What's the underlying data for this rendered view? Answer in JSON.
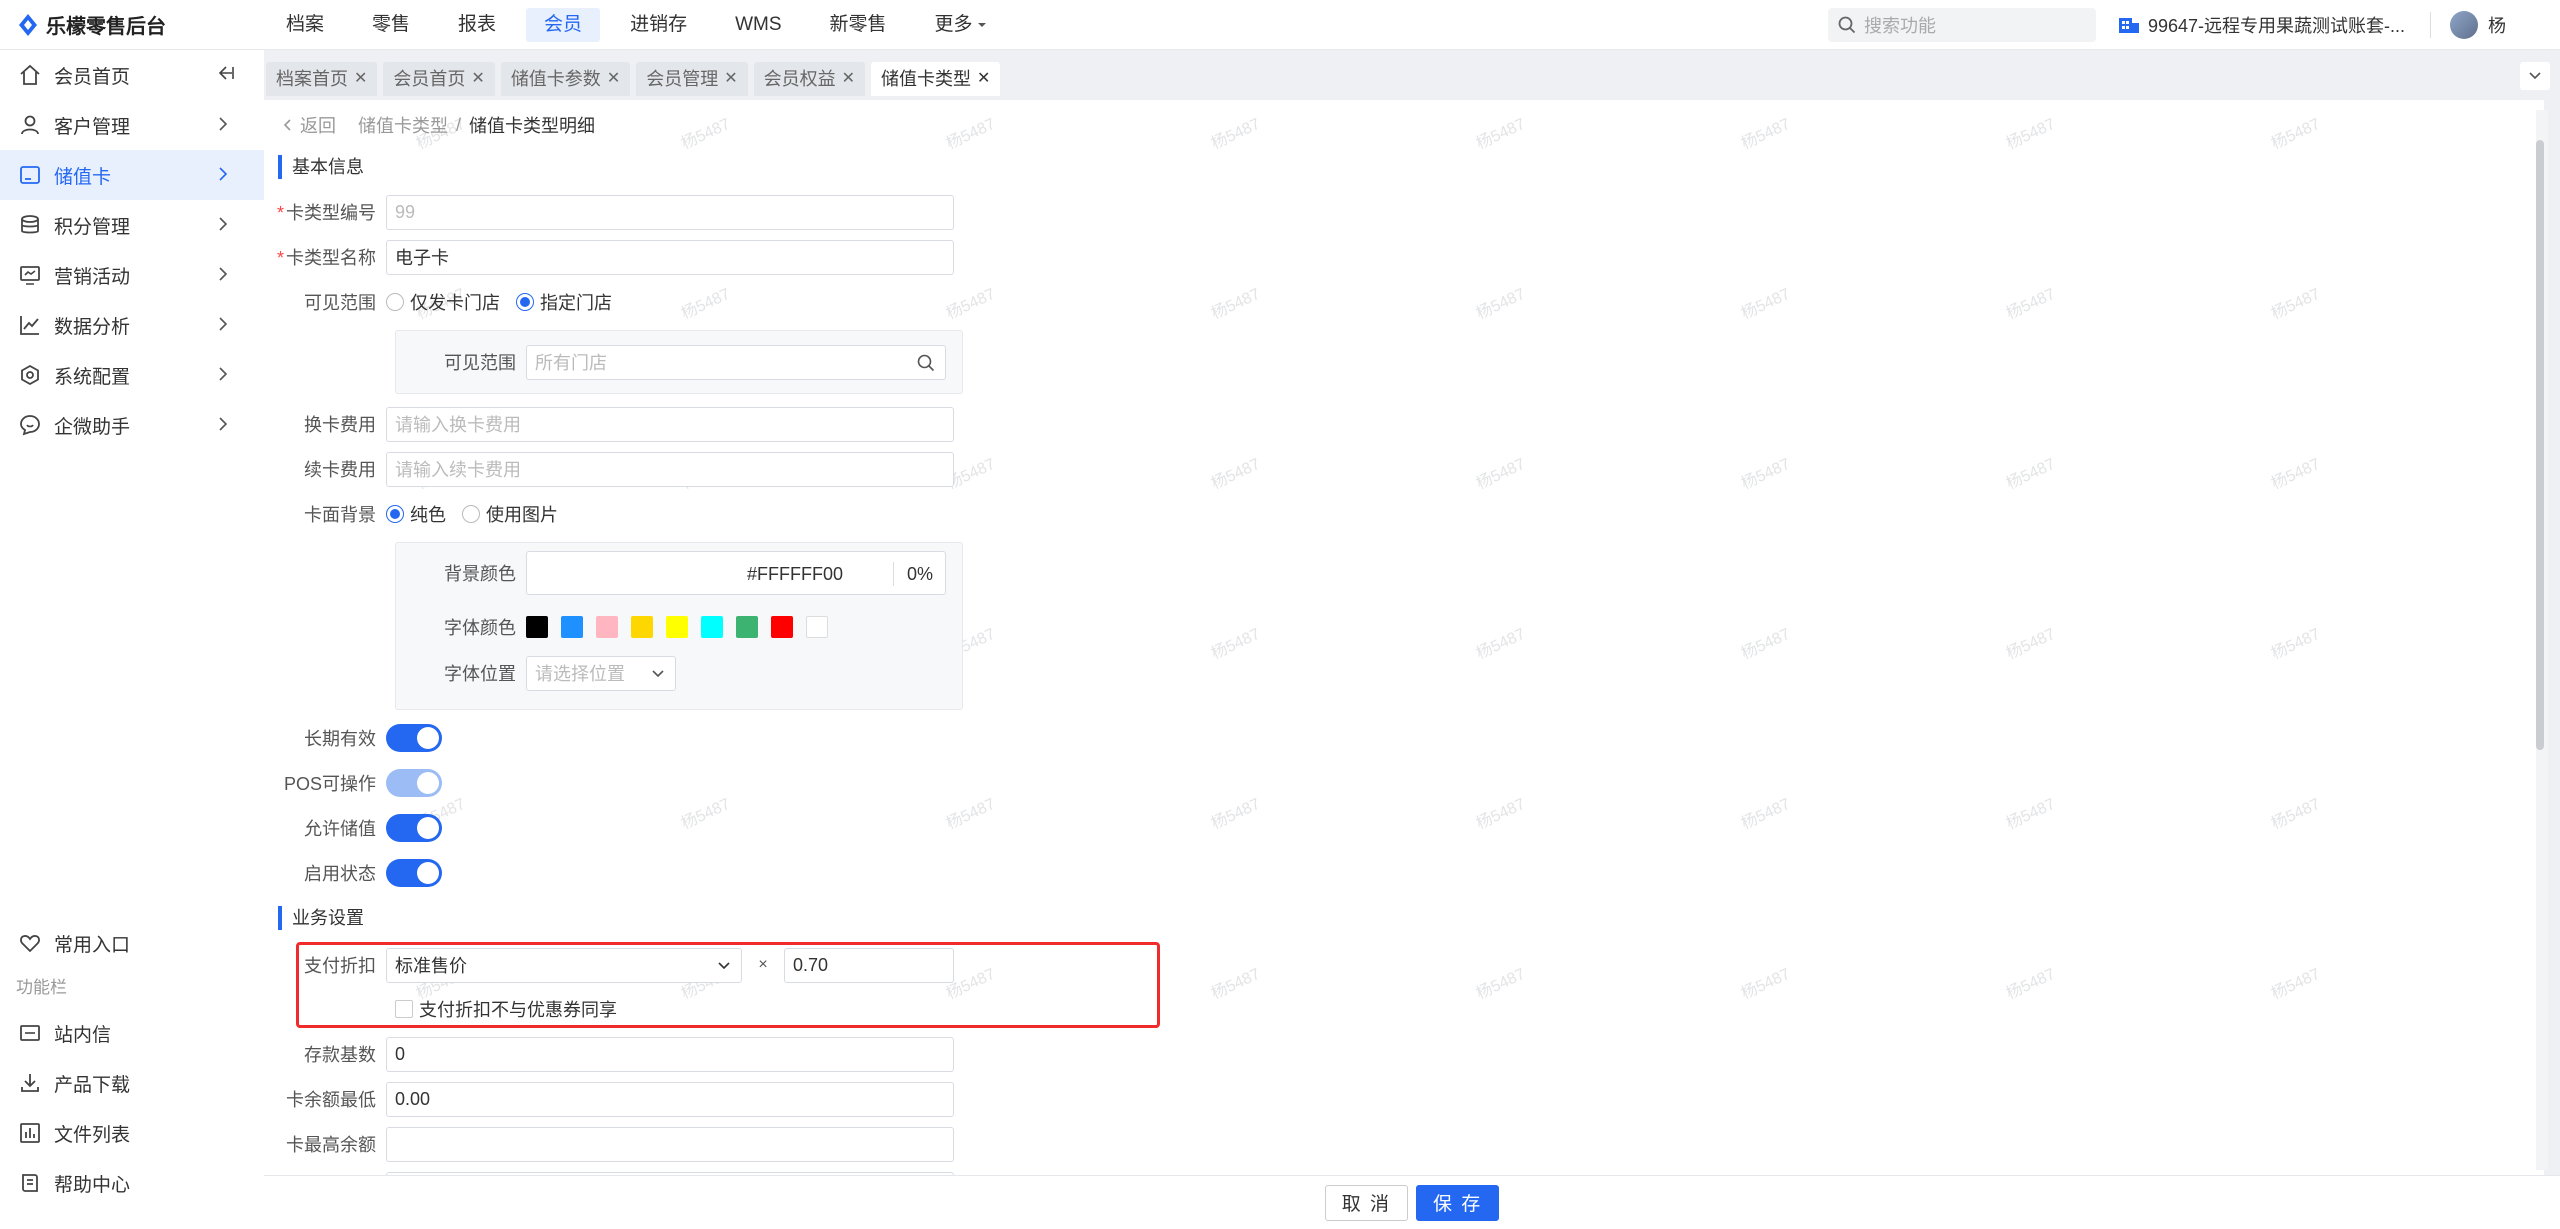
{
  "header": {
    "brand": "乐檬零售后台",
    "nav": [
      "档案",
      "零售",
      "报表",
      "会员",
      "进销存",
      "WMS",
      "新零售",
      "更多"
    ],
    "active_nav": "会员",
    "search_placeholder": "搜索功能",
    "store": "99647-远程专用果蔬测试账套-...",
    "user": "杨"
  },
  "sidebar": {
    "items": [
      "会员首页",
      "客户管理",
      "储值卡",
      "积分管理",
      "营销活动",
      "数据分析",
      "系统配置",
      "企微助手"
    ],
    "active": "储值卡",
    "favorites": "常用入口",
    "section_caption": "功能栏",
    "tools": [
      "站内信",
      "产品下载",
      "文件列表",
      "帮助中心"
    ]
  },
  "tabs": [
    "档案首页",
    "会员首页",
    "储值卡参数",
    "会员管理",
    "会员权益",
    "储值卡类型"
  ],
  "active_tab": "储值卡类型",
  "breadcrumb": {
    "back": "返回",
    "parent": "储值卡类型",
    "separator": "/",
    "current": "储值卡类型明细"
  },
  "watermark": "杨5487",
  "basic": {
    "title": "基本信息",
    "code_label": "卡类型编号",
    "code_value": "99",
    "name_label": "卡类型名称",
    "name_value": "电子卡",
    "visible_label": "可见范围",
    "visible_options": [
      "仅发卡门店",
      "指定门店"
    ],
    "visible_selected": "指定门店",
    "sub_visible_label": "可见范围",
    "sub_visible_placeholder": "所有门店",
    "change_fee_label": "换卡费用",
    "change_fee_placeholder": "请输入换卡费用",
    "renew_fee_label": "续卡费用",
    "renew_fee_placeholder": "请输入续卡费用",
    "bg_label": "卡面背景",
    "bg_options": [
      "纯色",
      "使用图片"
    ],
    "bg_selected": "纯色",
    "bg_color_label": "背景颜色",
    "bg_color_value": "#FFFFFF00",
    "bg_opacity": "0%",
    "font_color_label": "字体颜色",
    "font_colors": [
      "#000000",
      "#1e90ff",
      "#ffb6c1",
      "#ffd700",
      "#ffff00",
      "#00ffff",
      "#3cb371",
      "#ff0000",
      "#ffffff"
    ],
    "font_pos_label": "字体位置",
    "font_pos_placeholder": "请选择位置",
    "long_valid_label": "长期有效",
    "pos_label": "POS可操作",
    "allow_store_label": "允许储值",
    "enable_label": "启用状态"
  },
  "business": {
    "title": "业务设置",
    "discount_label": "支付折扣",
    "discount_select": "标准售价",
    "multiply": "×",
    "discount_value": "0.70",
    "coupon_checkbox": "支付折扣不与优惠券同享",
    "deposit_label": "存款基数",
    "deposit_value": "0",
    "min_balance_label": "卡余额最低",
    "min_balance_value": "0.00",
    "max_balance_label": "卡最高余额",
    "max_balance_value": ""
  },
  "footer": {
    "cancel": "取 消",
    "save": "保 存"
  },
  "colors": {
    "accent": "#2468f2",
    "highlight": "#f12b2b"
  }
}
